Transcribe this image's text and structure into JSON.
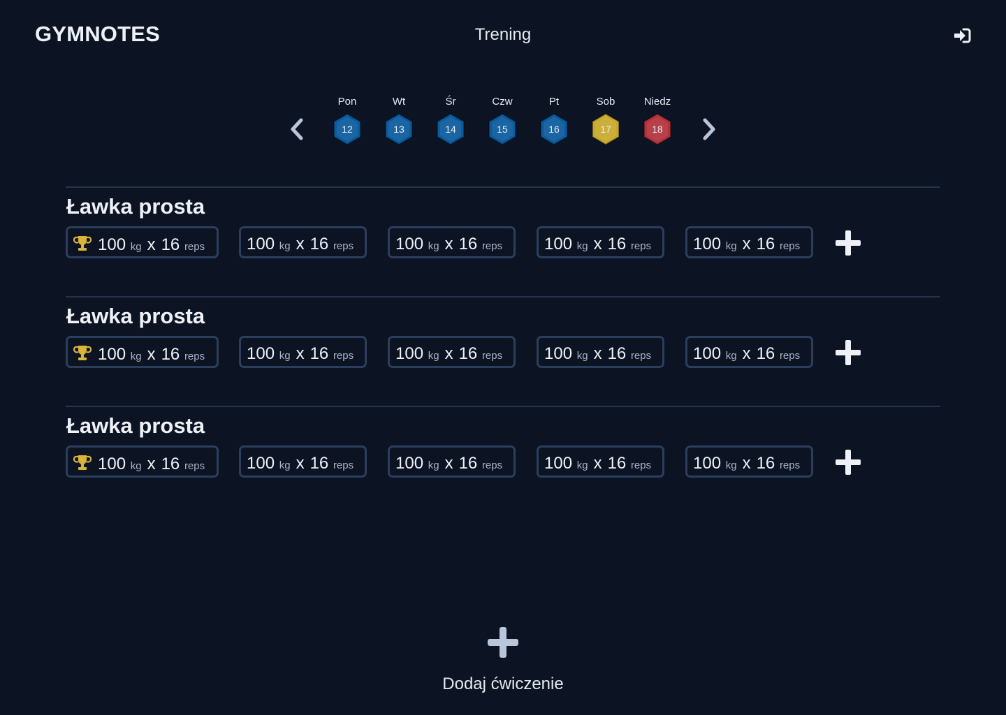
{
  "header": {
    "brand": "GYMNOTES",
    "title": "Trening",
    "login_icon": "sign-in-icon"
  },
  "week": {
    "prev_icon": "chevron-left-icon",
    "next_icon": "chevron-right-icon",
    "days": [
      {
        "label": "Pon",
        "number": "12",
        "color": "#0a5a9c",
        "state": "default"
      },
      {
        "label": "Wt",
        "number": "13",
        "color": "#0a5a9c",
        "state": "default"
      },
      {
        "label": "Śr",
        "number": "14",
        "color": "#0a5a9c",
        "state": "default"
      },
      {
        "label": "Czw",
        "number": "15",
        "color": "#0a5a9c",
        "state": "default"
      },
      {
        "label": "Pt",
        "number": "16",
        "color": "#0a5a9c",
        "state": "default"
      },
      {
        "label": "Sob",
        "number": "17",
        "color": "#c9a92c",
        "state": "highlighted"
      },
      {
        "label": "Niedz",
        "number": "18",
        "color": "#b2323c",
        "state": "highlighted"
      }
    ]
  },
  "exercises": [
    {
      "name": "Ławka prosta",
      "sets": [
        {
          "weight": "100",
          "weight_unit": "kg",
          "sep": "x",
          "reps": "16",
          "reps_unit": "reps",
          "record": true
        },
        {
          "weight": "100",
          "weight_unit": "kg",
          "sep": "x",
          "reps": "16",
          "reps_unit": "reps",
          "record": false
        },
        {
          "weight": "100",
          "weight_unit": "kg",
          "sep": "x",
          "reps": "16",
          "reps_unit": "reps",
          "record": false
        },
        {
          "weight": "100",
          "weight_unit": "kg",
          "sep": "x",
          "reps": "16",
          "reps_unit": "reps",
          "record": false
        },
        {
          "weight": "100",
          "weight_unit": "kg",
          "sep": "x",
          "reps": "16",
          "reps_unit": "reps",
          "record": false
        }
      ]
    },
    {
      "name": "Ławka prosta",
      "sets": [
        {
          "weight": "100",
          "weight_unit": "kg",
          "sep": "x",
          "reps": "16",
          "reps_unit": "reps",
          "record": true
        },
        {
          "weight": "100",
          "weight_unit": "kg",
          "sep": "x",
          "reps": "16",
          "reps_unit": "reps",
          "record": false
        },
        {
          "weight": "100",
          "weight_unit": "kg",
          "sep": "x",
          "reps": "16",
          "reps_unit": "reps",
          "record": false
        },
        {
          "weight": "100",
          "weight_unit": "kg",
          "sep": "x",
          "reps": "16",
          "reps_unit": "reps",
          "record": false
        },
        {
          "weight": "100",
          "weight_unit": "kg",
          "sep": "x",
          "reps": "16",
          "reps_unit": "reps",
          "record": false
        }
      ]
    },
    {
      "name": "Ławka prosta",
      "sets": [
        {
          "weight": "100",
          "weight_unit": "kg",
          "sep": "x",
          "reps": "16",
          "reps_unit": "reps",
          "record": true
        },
        {
          "weight": "100",
          "weight_unit": "kg",
          "sep": "x",
          "reps": "16",
          "reps_unit": "reps",
          "record": false
        },
        {
          "weight": "100",
          "weight_unit": "kg",
          "sep": "x",
          "reps": "16",
          "reps_unit": "reps",
          "record": false
        },
        {
          "weight": "100",
          "weight_unit": "kg",
          "sep": "x",
          "reps": "16",
          "reps_unit": "reps",
          "record": false
        },
        {
          "weight": "100",
          "weight_unit": "kg",
          "sep": "x",
          "reps": "16",
          "reps_unit": "reps",
          "record": false
        }
      ]
    }
  ],
  "add_exercise": {
    "label": "Dodaj ćwiczenie",
    "icon": "plus-icon"
  },
  "colors": {
    "background": "#0c1424",
    "border": "#2d3e5c",
    "trophy": "#d8b43a",
    "muted_icon": "#b9c6da"
  }
}
